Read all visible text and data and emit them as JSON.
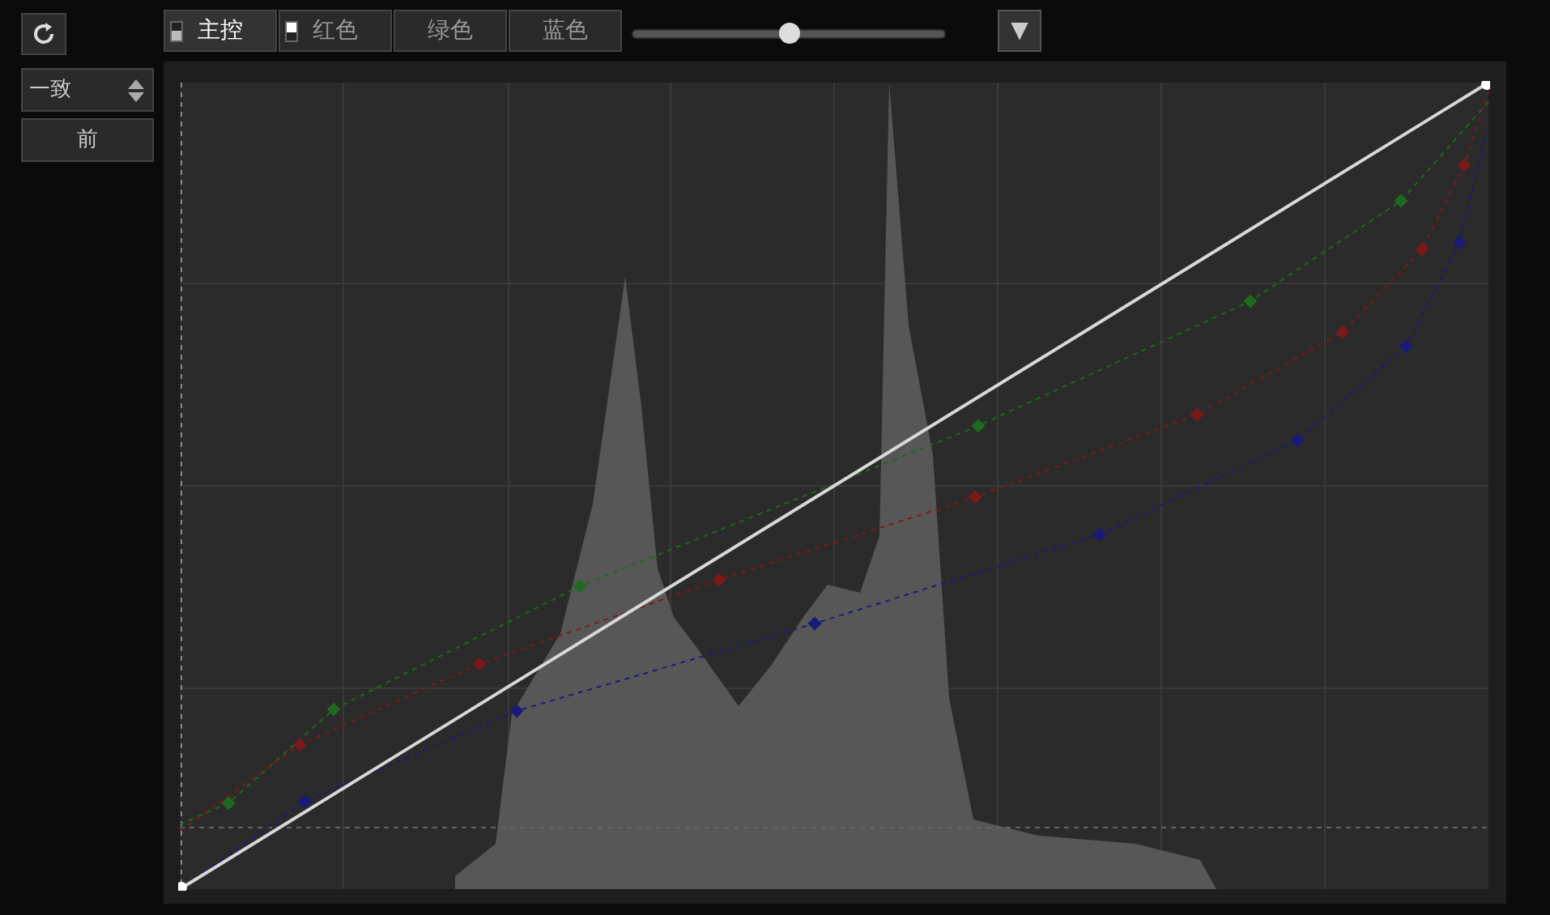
{
  "side_panel": {
    "mode_select": {
      "value": "一致"
    },
    "before_button": {
      "label": "前"
    }
  },
  "tabs": [
    {
      "label": "主控",
      "selected": true,
      "indicator_on": false
    },
    {
      "label": "红色",
      "selected": false,
      "indicator_on": true
    },
    {
      "label": "绿色",
      "selected": false
    },
    {
      "label": "蓝色",
      "selected": false
    }
  ],
  "intensity_slider": {
    "level": 0.5
  },
  "menu_button": {
    "label": "▼"
  }
}
